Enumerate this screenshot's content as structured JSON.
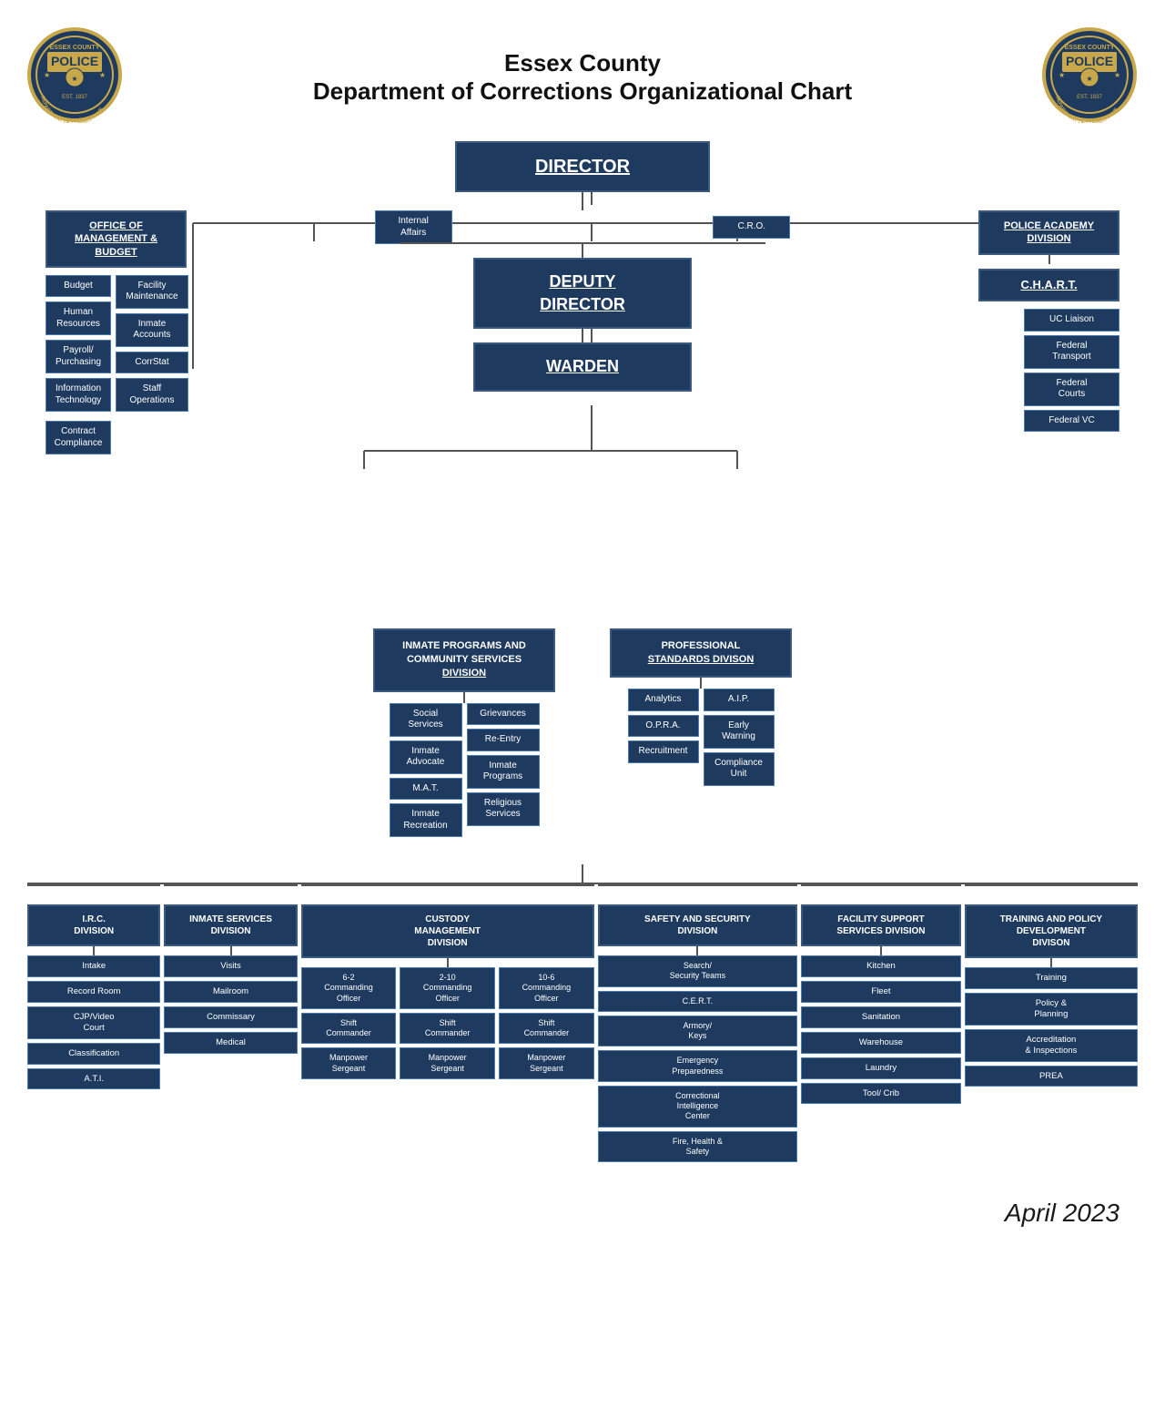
{
  "header": {
    "title_line1": "Essex County",
    "title_line2": "Department of Corrections Organizational Chart"
  },
  "director": "DIRECTOR",
  "deputy_director": "DEPUTY\nDIRECTOR",
  "warden": "WARDEN",
  "office_mgmt": "OFFICE OF\nMANAGEMENT & BUDGET",
  "police_academy": "POLICE ACADEMY\nDIVISION",
  "chart": "C.H.A.R.T.",
  "internal_affairs": "Internal\nAffairs",
  "cro": "C.R.O.",
  "left_column": [
    "Budget",
    "Human\nResources",
    "Payroll/\nPurchasing",
    "Information\nTechnology",
    "Contract\nCompliance"
  ],
  "right_column": [
    "Facility\nMaintenance",
    "Inmate\nAccounts",
    "CorrStat",
    "Staff\nOperations"
  ],
  "chart_children": [
    "UC Liaison",
    "Federal\nTransport",
    "Federal\nCourts",
    "Federal VC"
  ],
  "inmate_programs": "INMATE PROGRAMS AND\nCOMMUNITY SERVICES\nDIVISION",
  "professional_standards": "PROFESSIONAL\nSTANDARDS DIVISON",
  "inmate_programs_left": [
    "Social\nServices",
    "Inmate\nAdvocate",
    "M.A.T.",
    "Inmate\nRecreation"
  ],
  "inmate_programs_right": [
    "Grievances",
    "Re-Entry",
    "Inmate\nPrograms",
    "Religious\nServices"
  ],
  "prof_standards_left": [
    "Analytics",
    "O.P.R.A.",
    "Recruitment"
  ],
  "prof_standards_right": [
    "A.I.P.",
    "Early\nWarning",
    "Compliance\nUnit"
  ],
  "bottom_divisions": [
    {
      "name": "I.R.C.\nDIVISION",
      "children": [
        "Intake",
        "Record Room",
        "CJP/Video\nCourt",
        "Classification",
        "A.T.I."
      ]
    },
    {
      "name": "INMATE SERVICES\nDIVISION",
      "children": [
        "Visits",
        "Mailroom",
        "Commissary",
        "Medical"
      ]
    },
    {
      "name": "CUSTODY\nMANAGEMENT\nDIVISION",
      "sub_cols": [
        {
          "label": "6-2\nCommanding\nOfficer",
          "children": [
            "Shift\nCommander",
            "Manpower\nSergeant"
          ]
        },
        {
          "label": "2-10\nCommanding\nOfficer",
          "children": [
            "Shift\nCommander",
            "Manpower\nSergeant"
          ]
        },
        {
          "label": "10-6\nCommanding\nOfficer",
          "children": [
            "Shift\nCommander",
            "Manpower\nSergeant"
          ]
        }
      ]
    },
    {
      "name": "SAFETY AND SECURITY\nDIVISION",
      "children": [
        "Search/\nSecurity Teams",
        "C.E.R.T.",
        "Armory/\nKeys",
        "Emergency\nPreparedness",
        "Correctional\nIntelligence\nCenter",
        "Fire, Health &\nSafety"
      ]
    },
    {
      "name": "FACILITY SUPPORT\nSERVICES DIVISION",
      "children": [
        "Kitchen",
        "Fleet",
        "Sanitation",
        "Warehouse",
        "Laundry",
        "Tool/ Crib"
      ]
    },
    {
      "name": "TRAINING AND POLICY\nDEVELOPMENT\nDIVISION",
      "children": [
        "Training",
        "Policy &\nPlanning",
        "Accreditation\n& Inspections",
        "PREA"
      ]
    }
  ],
  "footer": {
    "date": "April 2023"
  }
}
